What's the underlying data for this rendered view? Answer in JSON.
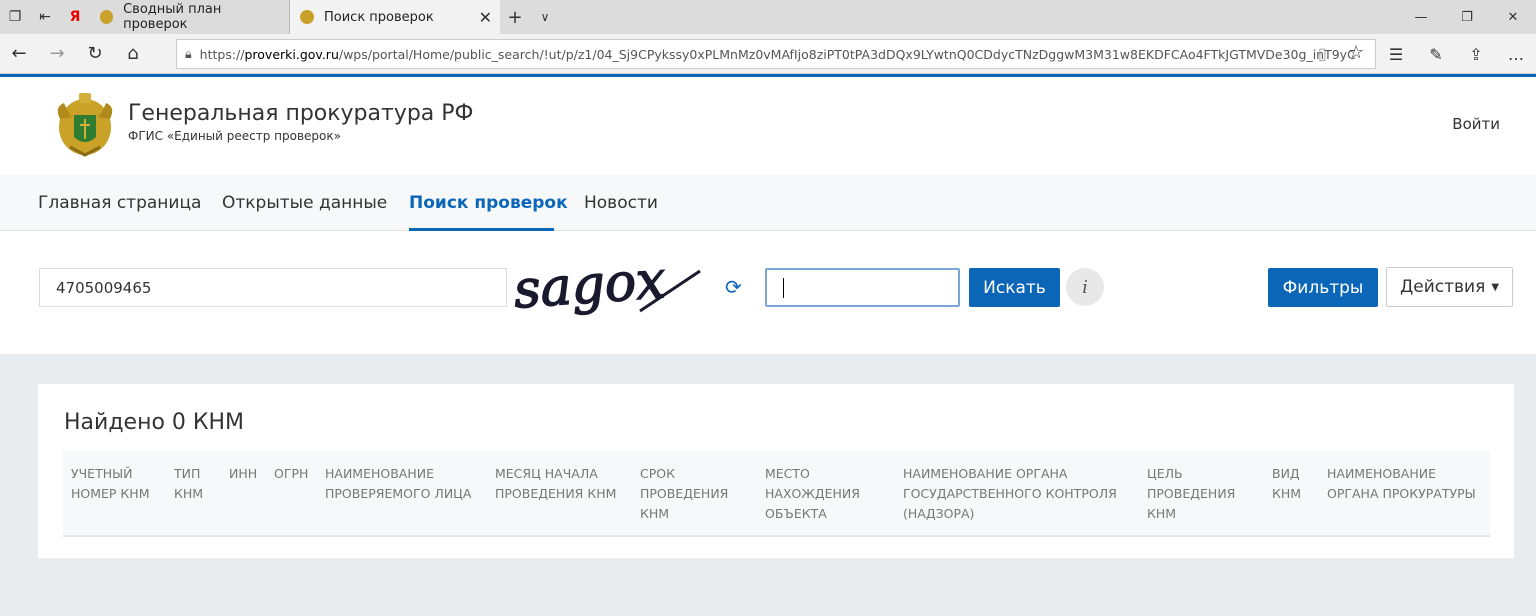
{
  "browser": {
    "tabs": [
      {
        "label": "Сводный план проверок"
      },
      {
        "label": "Поиск проверок"
      }
    ],
    "yandex_glyph": "Я",
    "url": {
      "scheme": "https://",
      "domain": "proverki.gov.ru",
      "path": "/wps/portal/Home/public_search/!ut/p/z1/04_Sj9CPykssy0xPLMnMz0vMAfIjo8ziPT0tPA3dDQx9LYwtnQ0CDdycTNzDggwM3M31w8EKDFCAo4FTkJGTMVDe30g_inT9yC"
    }
  },
  "header": {
    "title": "Генеральная прокуратура РФ",
    "subtitle": "ФГИС «Единый реестр проверок»",
    "login": "Войти"
  },
  "nav": {
    "items": [
      {
        "label": "Главная страница"
      },
      {
        "label": "Открытые данные"
      },
      {
        "label": "Поиск проверок"
      },
      {
        "label": "Новости"
      }
    ]
  },
  "search": {
    "inn_value": "4705009465",
    "captcha_text": "sagox",
    "captcha_value": "",
    "search_label": "Искать",
    "info_label": "i",
    "filters_label": "Фильтры",
    "actions_label": "Действия"
  },
  "results": {
    "title": "Найдено 0 КНМ",
    "columns": [
      "УЧЕТНЫЙ\nНОМЕР КНМ",
      "ТИП\nКНМ",
      "ИНН",
      "ОГРН",
      "НАИМЕНОВАНИЕ\nПРОВЕРЯЕМОГО ЛИЦА",
      "МЕСЯЦ НАЧАЛА\nПРОВЕДЕНИЯ КНМ",
      "СРОК\nПРОВЕДЕНИЯ\nКНМ",
      "МЕСТО\nНАХОЖДЕНИЯ\nОБЪЕКТА",
      "НАИМЕНОВАНИЕ ОРГАНА\nГОСУДАРСТВЕННОГО КОНТРОЛЯ\n(НАДЗОРА)",
      "ЦЕЛЬ\nПРОВЕДЕНИЯ\nКНМ",
      "ВИД\nКНМ",
      "НАИМЕНОВАНИЕ\nОРГАНА ПРОКУРАТУРЫ"
    ]
  },
  "colors": {
    "accent": "#0b66b8"
  }
}
